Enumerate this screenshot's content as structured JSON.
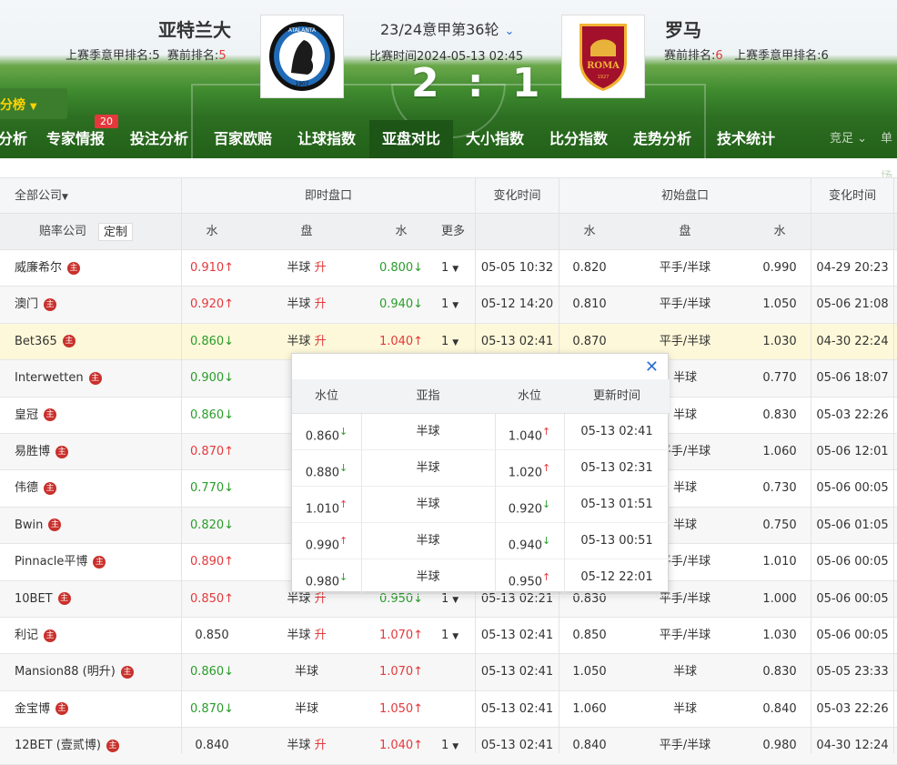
{
  "match": {
    "home": "亚特兰大",
    "away": "罗马",
    "home_rank_last": "上赛季意甲排名:5",
    "home_rank_pre_label": "赛前排名:",
    "home_rank_pre": "5",
    "away_rank_pre_label": "赛前排名:",
    "away_rank_pre": "6",
    "away_rank_last": "上赛季意甲排名:6",
    "round": "23/24意甲第36轮",
    "time": "比赛时间2024-05-13 02:45",
    "score": "2 : 1",
    "home_logo_text": "ATALANTA",
    "home_logo_year": "1907",
    "away_logo_text": "ROMA",
    "away_logo_year": "1927"
  },
  "ranking_tab": "分榜",
  "nav": {
    "items": [
      "分析",
      "专家情报",
      "投注分析",
      "百家欧赔",
      "让球指数",
      "亚盘对比",
      "大小指数",
      "比分指数",
      "走势分析",
      "技术统计"
    ],
    "badge": "20",
    "right1": "竞足",
    "right2": "单场"
  },
  "table": {
    "company_filter": "全部公司",
    "instant_group": "即时盘口",
    "change_time": "变化时间",
    "initial_group": "初始盘口",
    "odds_company": "赔率公司",
    "customize": "定制",
    "water": "水",
    "handicap": "盘",
    "more": "更多",
    "rows": [
      {
        "name": "威廉希尔",
        "w1": "0.910",
        "w1d": "up",
        "h": "半球",
        "hs": "升",
        "w2": "0.800",
        "w2d": "down",
        "more": "1",
        "t1": "05-05 10:32",
        "iw1": "0.820",
        "ih": "平手/半球",
        "iw2": "0.990",
        "t2": "04-29 20:23"
      },
      {
        "name": "澳门",
        "w1": "0.920",
        "w1d": "up",
        "h": "半球",
        "hs": "升",
        "w2": "0.940",
        "w2d": "down",
        "more": "1",
        "t1": "05-12 14:20",
        "iw1": "0.810",
        "ih": "平手/半球",
        "iw2": "1.050",
        "t2": "05-06 21:08"
      },
      {
        "name": "Bet365",
        "w1": "0.860",
        "w1d": "down",
        "h": "半球",
        "hs": "升",
        "w2": "1.040",
        "w2d": "up",
        "more": "1",
        "t1": "05-13 02:41",
        "iw1": "0.870",
        "ih": "平手/半球",
        "iw2": "1.030",
        "t2": "04-30 22:24"
      },
      {
        "name": "Interwetten",
        "w1": "0.900",
        "w1d": "down",
        "h": "",
        "hs": "",
        "w2": "",
        "w2d": "",
        "more": "",
        "t1": "",
        "iw1": "",
        "ih": "半球",
        "iw2": "0.770",
        "t2": "05-06 18:07"
      },
      {
        "name": "皇冠",
        "w1": "0.860",
        "w1d": "down",
        "h": "",
        "hs": "",
        "w2": "",
        "w2d": "",
        "more": "",
        "t1": "",
        "iw1": "",
        "ih": "半球",
        "iw2": "0.830",
        "t2": "05-03 22:26"
      },
      {
        "name": "易胜博",
        "w1": "0.870",
        "w1d": "up",
        "h": "",
        "hs": "",
        "w2": "",
        "w2d": "",
        "more": "",
        "t1": "",
        "iw1": "",
        "ih": "平手/半球",
        "iw2": "1.060",
        "t2": "05-06 12:01"
      },
      {
        "name": "伟德",
        "w1": "0.770",
        "w1d": "down",
        "h": "",
        "hs": "",
        "w2": "",
        "w2d": "",
        "more": "",
        "t1": "",
        "iw1": "",
        "ih": "半球",
        "iw2": "0.730",
        "t2": "05-06 00:05"
      },
      {
        "name": "Bwin",
        "w1": "0.820",
        "w1d": "down",
        "h": "",
        "hs": "",
        "w2": "",
        "w2d": "",
        "more": "",
        "t1": "",
        "iw1": "",
        "ih": "半球",
        "iw2": "0.750",
        "t2": "05-06 01:05"
      },
      {
        "name": "Pinnacle平博",
        "w1": "0.890",
        "w1d": "up",
        "h": "",
        "hs": "",
        "w2": "",
        "w2d": "",
        "more": "",
        "t1": "",
        "iw1": "",
        "ih": "平手/半球",
        "iw2": "1.010",
        "t2": "05-06 00:05"
      },
      {
        "name": "10BET",
        "w1": "0.850",
        "w1d": "up",
        "h": "半球",
        "hs": "升",
        "w2": "0.950",
        "w2d": "down",
        "more": "1",
        "t1": "05-13 02:21",
        "iw1": "0.830",
        "ih": "平手/半球",
        "iw2": "1.000",
        "t2": "05-06 00:05"
      },
      {
        "name": "利记",
        "w1": "0.850",
        "w1d": "",
        "h": "半球",
        "hs": "升",
        "w2": "1.070",
        "w2d": "up",
        "more": "1",
        "t1": "05-13 02:41",
        "iw1": "0.850",
        "ih": "平手/半球",
        "iw2": "1.030",
        "t2": "05-06 00:05"
      },
      {
        "name": "Mansion88 (明升)",
        "w1": "0.860",
        "w1d": "down",
        "h": "半球",
        "hs": "",
        "w2": "1.070",
        "w2d": "up",
        "more": "",
        "t1": "05-13 02:41",
        "iw1": "1.050",
        "ih": "半球",
        "iw2": "0.830",
        "t2": "05-05 23:33"
      },
      {
        "name": "金宝博",
        "w1": "0.870",
        "w1d": "down",
        "h": "半球",
        "hs": "",
        "w2": "1.050",
        "w2d": "up",
        "more": "",
        "t1": "05-13 02:41",
        "iw1": "1.060",
        "ih": "半球",
        "iw2": "0.840",
        "t2": "05-03 22:26"
      },
      {
        "name": "12BET (壹贰博)",
        "w1": "0.840",
        "w1d": "",
        "h": "半球",
        "hs": "升",
        "w2": "1.040",
        "w2d": "up",
        "more": "1",
        "t1": "05-13 02:41",
        "iw1": "0.840",
        "ih": "平手/半球",
        "iw2": "0.980",
        "t2": "04-30 12:24"
      }
    ]
  },
  "popup": {
    "headers": [
      "水位",
      "亚指",
      "水位",
      "更新时间"
    ],
    "rows": [
      {
        "w1": "0.860",
        "w1d": "down",
        "h": "半球",
        "w2": "1.040",
        "w2d": "up",
        "t": "05-13 02:41"
      },
      {
        "w1": "0.880",
        "w1d": "down",
        "h": "半球",
        "w2": "1.020",
        "w2d": "up",
        "t": "05-13 02:31"
      },
      {
        "w1": "1.010",
        "w1d": "up",
        "h": "半球",
        "w2": "0.920",
        "w2d": "down",
        "t": "05-13 01:51"
      },
      {
        "w1": "0.990",
        "w1d": "up",
        "h": "半球",
        "w2": "0.940",
        "w2d": "down",
        "t": "05-13 00:51"
      },
      {
        "w1": "0.980",
        "w1d": "down",
        "h": "半球",
        "w2": "0.950",
        "w2d": "up",
        "t": "05-12 22:01"
      }
    ]
  }
}
